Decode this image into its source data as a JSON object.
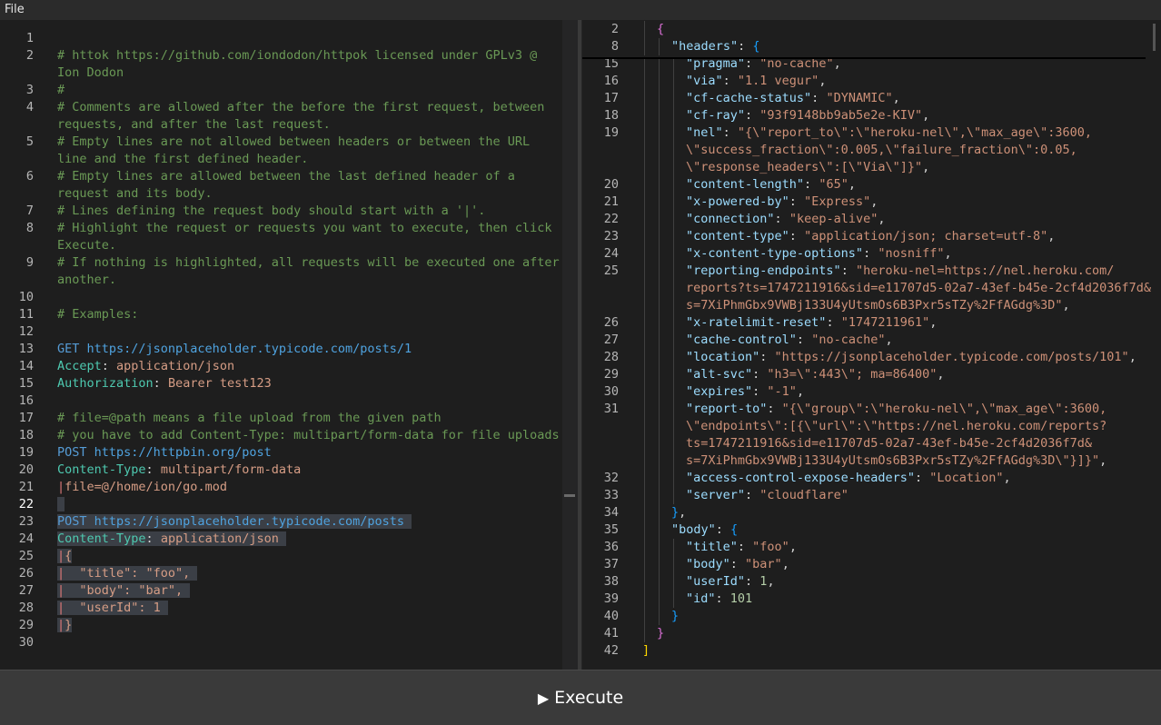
{
  "menu": {
    "file": "File"
  },
  "execute": {
    "icon": "play-icon",
    "label": "Execute"
  },
  "editor": {
    "lines": [
      {
        "n": "1"
      },
      {
        "n": "2",
        "segs": [
          {
            "t": "# httok https://github.com/iondodon/httpok licensed under GPLv3 @",
            "c": "comment"
          }
        ]
      },
      {
        "segs": [
          {
            "t": "Ion Dodon",
            "c": "comment"
          }
        ]
      },
      {
        "n": "3",
        "segs": [
          {
            "t": "#",
            "c": "comment"
          }
        ]
      },
      {
        "n": "4",
        "segs": [
          {
            "t": "# Comments are allowed after the before the first request, between",
            "c": "comment"
          }
        ]
      },
      {
        "segs": [
          {
            "t": "requests, and after the last request.",
            "c": "comment"
          }
        ]
      },
      {
        "n": "5",
        "segs": [
          {
            "t": "# Empty lines are not allowed between headers or between the URL",
            "c": "comment"
          }
        ]
      },
      {
        "segs": [
          {
            "t": "line and the first defined header.",
            "c": "comment"
          }
        ]
      },
      {
        "n": "6",
        "segs": [
          {
            "t": "# Empty lines are allowed between the last defined header of a",
            "c": "comment"
          }
        ]
      },
      {
        "segs": [
          {
            "t": "request and its body.",
            "c": "comment"
          }
        ]
      },
      {
        "n": "7",
        "segs": [
          {
            "t": "# Lines defining the request body should start with a '|'.",
            "c": "comment"
          }
        ]
      },
      {
        "n": "8",
        "segs": [
          {
            "t": "# Highlight the request or requests you want to execute, then click",
            "c": "comment"
          }
        ]
      },
      {
        "segs": [
          {
            "t": "Execute.",
            "c": "comment"
          }
        ]
      },
      {
        "n": "9",
        "segs": [
          {
            "t": "# If nothing is highlighted, all requests will be executed one after",
            "c": "comment"
          }
        ]
      },
      {
        "segs": [
          {
            "t": "another.",
            "c": "comment"
          }
        ]
      },
      {
        "n": "10"
      },
      {
        "n": "11",
        "segs": [
          {
            "t": "# Examples:",
            "c": "comment"
          }
        ]
      },
      {
        "n": "12"
      },
      {
        "n": "13",
        "segs": [
          {
            "t": "GET ",
            "c": "method"
          },
          {
            "t": "https://jsonplaceholder.typicode.com/posts/1",
            "c": "url"
          }
        ]
      },
      {
        "n": "14",
        "segs": [
          {
            "t": "Accept",
            "c": "hkey"
          },
          {
            "t": ": ",
            "c": "plain"
          },
          {
            "t": "application/json",
            "c": "hval"
          }
        ]
      },
      {
        "n": "15",
        "segs": [
          {
            "t": "Authorization",
            "c": "hkey"
          },
          {
            "t": ": ",
            "c": "plain"
          },
          {
            "t": "Bearer test123",
            "c": "hval"
          }
        ]
      },
      {
        "n": "16"
      },
      {
        "n": "17",
        "segs": [
          {
            "t": "# file=@path means a file upload from the given path",
            "c": "comment"
          }
        ]
      },
      {
        "n": "18",
        "segs": [
          {
            "t": "# you have to add Content-Type: multipart/form-data for file uploads",
            "c": "comment"
          }
        ]
      },
      {
        "n": "19",
        "segs": [
          {
            "t": "POST ",
            "c": "method"
          },
          {
            "t": "https://httpbin.org/post",
            "c": "url"
          }
        ]
      },
      {
        "n": "20",
        "segs": [
          {
            "t": "Content-Type",
            "c": "hkey"
          },
          {
            "t": ": ",
            "c": "plain"
          },
          {
            "t": "multipart/form-data",
            "c": "hval"
          }
        ]
      },
      {
        "n": "21",
        "segs": [
          {
            "t": "|",
            "c": "pipe"
          },
          {
            "t": "file=@/home/ion/go.mod",
            "c": "body"
          }
        ]
      },
      {
        "n": "22",
        "active": true,
        "hl": true,
        "segs": [
          {
            "t": " ",
            "c": "plain"
          }
        ]
      },
      {
        "n": "23",
        "hl": true,
        "segs": [
          {
            "t": "POST ",
            "c": "method"
          },
          {
            "t": "https://jsonplaceholder.typicode.com/posts ",
            "c": "url"
          }
        ]
      },
      {
        "n": "24",
        "hl": true,
        "segs": [
          {
            "t": "Content-Type",
            "c": "hkey"
          },
          {
            "t": ": ",
            "c": "plain"
          },
          {
            "t": "application/json ",
            "c": "hval"
          }
        ]
      },
      {
        "n": "25",
        "hl": true,
        "segs": [
          {
            "t": "|",
            "c": "pipe"
          },
          {
            "t": "{",
            "c": "body"
          }
        ]
      },
      {
        "n": "26",
        "hl": true,
        "segs": [
          {
            "t": "|",
            "c": "pipe"
          },
          {
            "t": "  \"title\": \"foo\", ",
            "c": "body"
          }
        ]
      },
      {
        "n": "27",
        "hl": true,
        "segs": [
          {
            "t": "|",
            "c": "pipe"
          },
          {
            "t": "  \"body\": \"bar\", ",
            "c": "body"
          }
        ]
      },
      {
        "n": "28",
        "hl": true,
        "segs": [
          {
            "t": "|",
            "c": "pipe"
          },
          {
            "t": "  \"userId\": 1 ",
            "c": "body"
          }
        ]
      },
      {
        "n": "29",
        "hl": true,
        "segs": [
          {
            "t": "|",
            "c": "pipe"
          },
          {
            "t": "}",
            "c": "body"
          }
        ]
      },
      {
        "n": "30"
      }
    ]
  },
  "response": {
    "sticky": [
      {
        "n": "2",
        "indent": 1,
        "segs": [
          {
            "t": "{",
            "c": "br1"
          }
        ]
      },
      {
        "n": "8",
        "indent": 2,
        "segs": [
          {
            "t": "\"headers\"",
            "c": "key"
          },
          {
            "t": ": ",
            "c": "punct"
          },
          {
            "t": "{",
            "c": "br2"
          }
        ]
      }
    ],
    "lines": [
      {
        "n": "15",
        "indent": 3,
        "segs": [
          {
            "t": "\"pragma\"",
            "c": "key"
          },
          {
            "t": ": ",
            "c": "punct"
          },
          {
            "t": "\"no-cache\"",
            "c": "str"
          },
          {
            "t": ",",
            "c": "punct"
          }
        ]
      },
      {
        "n": "16",
        "indent": 3,
        "segs": [
          {
            "t": "\"via\"",
            "c": "key"
          },
          {
            "t": ": ",
            "c": "punct"
          },
          {
            "t": "\"1.1 vegur\"",
            "c": "str"
          },
          {
            "t": ",",
            "c": "punct"
          }
        ]
      },
      {
        "n": "17",
        "indent": 3,
        "segs": [
          {
            "t": "\"cf-cache-status\"",
            "c": "key"
          },
          {
            "t": ": ",
            "c": "punct"
          },
          {
            "t": "\"DYNAMIC\"",
            "c": "str"
          },
          {
            "t": ",",
            "c": "punct"
          }
        ]
      },
      {
        "n": "18",
        "indent": 3,
        "segs": [
          {
            "t": "\"cf-ray\"",
            "c": "key"
          },
          {
            "t": ": ",
            "c": "punct"
          },
          {
            "t": "\"93f9148bb9ab5e2e-KIV\"",
            "c": "str"
          },
          {
            "t": ",",
            "c": "punct"
          }
        ]
      },
      {
        "n": "19",
        "indent": 3,
        "segs": [
          {
            "t": "\"nel\"",
            "c": "key"
          },
          {
            "t": ": ",
            "c": "punct"
          },
          {
            "t": "\"{\\\"report_to\\\":\\\"heroku-nel\\\",\\\"max_age\\\":3600,",
            "c": "str"
          }
        ]
      },
      {
        "indent": 3,
        "segs": [
          {
            "t": "\\\"success_fraction\\\":0.005,\\\"failure_fraction\\\":0.05,",
            "c": "str"
          }
        ]
      },
      {
        "indent": 3,
        "segs": [
          {
            "t": "\\\"response_headers\\\":[\\\"Via\\\"]}\"",
            "c": "str"
          },
          {
            "t": ",",
            "c": "punct"
          }
        ]
      },
      {
        "n": "20",
        "indent": 3,
        "segs": [
          {
            "t": "\"content-length\"",
            "c": "key"
          },
          {
            "t": ": ",
            "c": "punct"
          },
          {
            "t": "\"65\"",
            "c": "str"
          },
          {
            "t": ",",
            "c": "punct"
          }
        ]
      },
      {
        "n": "21",
        "indent": 3,
        "segs": [
          {
            "t": "\"x-powered-by\"",
            "c": "key"
          },
          {
            "t": ": ",
            "c": "punct"
          },
          {
            "t": "\"Express\"",
            "c": "str"
          },
          {
            "t": ",",
            "c": "punct"
          }
        ]
      },
      {
        "n": "22",
        "indent": 3,
        "segs": [
          {
            "t": "\"connection\"",
            "c": "key"
          },
          {
            "t": ": ",
            "c": "punct"
          },
          {
            "t": "\"keep-alive\"",
            "c": "str"
          },
          {
            "t": ",",
            "c": "punct"
          }
        ]
      },
      {
        "n": "23",
        "indent": 3,
        "segs": [
          {
            "t": "\"content-type\"",
            "c": "key"
          },
          {
            "t": ": ",
            "c": "punct"
          },
          {
            "t": "\"application/json; charset=utf-8\"",
            "c": "str"
          },
          {
            "t": ",",
            "c": "punct"
          }
        ]
      },
      {
        "n": "24",
        "indent": 3,
        "segs": [
          {
            "t": "\"x-content-type-options\"",
            "c": "key"
          },
          {
            "t": ": ",
            "c": "punct"
          },
          {
            "t": "\"nosniff\"",
            "c": "str"
          },
          {
            "t": ",",
            "c": "punct"
          }
        ]
      },
      {
        "n": "25",
        "indent": 3,
        "segs": [
          {
            "t": "\"reporting-endpoints\"",
            "c": "key"
          },
          {
            "t": ": ",
            "c": "punct"
          },
          {
            "t": "\"heroku-nel=https://nel.heroku.com/",
            "c": "str"
          }
        ]
      },
      {
        "indent": 3,
        "segs": [
          {
            "t": "reports?ts=1747211916&sid=e11707d5-02a7-43ef-b45e-2cf4d2036f7d&",
            "c": "str"
          }
        ]
      },
      {
        "indent": 3,
        "segs": [
          {
            "t": "s=7XiPhmGbx9VWBj133U4yUtsmOs6B3Pxr5sTZy%2FfAGdg%3D\"",
            "c": "str"
          },
          {
            "t": ",",
            "c": "punct"
          }
        ]
      },
      {
        "n": "26",
        "indent": 3,
        "segs": [
          {
            "t": "\"x-ratelimit-reset\"",
            "c": "key"
          },
          {
            "t": ": ",
            "c": "punct"
          },
          {
            "t": "\"1747211961\"",
            "c": "str"
          },
          {
            "t": ",",
            "c": "punct"
          }
        ]
      },
      {
        "n": "27",
        "indent": 3,
        "segs": [
          {
            "t": "\"cache-control\"",
            "c": "key"
          },
          {
            "t": ": ",
            "c": "punct"
          },
          {
            "t": "\"no-cache\"",
            "c": "str"
          },
          {
            "t": ",",
            "c": "punct"
          }
        ]
      },
      {
        "n": "28",
        "indent": 3,
        "segs": [
          {
            "t": "\"location\"",
            "c": "key"
          },
          {
            "t": ": ",
            "c": "punct"
          },
          {
            "t": "\"https://jsonplaceholder.typicode.com/posts/101\"",
            "c": "str"
          },
          {
            "t": ",",
            "c": "punct"
          }
        ]
      },
      {
        "n": "29",
        "indent": 3,
        "segs": [
          {
            "t": "\"alt-svc\"",
            "c": "key"
          },
          {
            "t": ": ",
            "c": "punct"
          },
          {
            "t": "\"h3=\\\":443\\\"; ma=86400\"",
            "c": "str"
          },
          {
            "t": ",",
            "c": "punct"
          }
        ]
      },
      {
        "n": "30",
        "indent": 3,
        "segs": [
          {
            "t": "\"expires\"",
            "c": "key"
          },
          {
            "t": ": ",
            "c": "punct"
          },
          {
            "t": "\"-1\"",
            "c": "str"
          },
          {
            "t": ",",
            "c": "punct"
          }
        ]
      },
      {
        "n": "31",
        "indent": 3,
        "segs": [
          {
            "t": "\"report-to\"",
            "c": "key"
          },
          {
            "t": ": ",
            "c": "punct"
          },
          {
            "t": "\"{\\\"group\\\":\\\"heroku-nel\\\",\\\"max_age\\\":3600,",
            "c": "str"
          }
        ]
      },
      {
        "indent": 3,
        "segs": [
          {
            "t": "\\\"endpoints\\\":[{\\\"url\\\":\\\"https://nel.heroku.com/reports?",
            "c": "str"
          }
        ]
      },
      {
        "indent": 3,
        "segs": [
          {
            "t": "ts=1747211916&sid=e11707d5-02a7-43ef-b45e-2cf4d2036f7d&",
            "c": "str"
          }
        ]
      },
      {
        "indent": 3,
        "segs": [
          {
            "t": "s=7XiPhmGbx9VWBj133U4yUtsmOs6B3Pxr5sTZy%2FfAGdg%3D\\\"}]}\"",
            "c": "str"
          },
          {
            "t": ",",
            "c": "punct"
          }
        ]
      },
      {
        "n": "32",
        "indent": 3,
        "segs": [
          {
            "t": "\"access-control-expose-headers\"",
            "c": "key"
          },
          {
            "t": ": ",
            "c": "punct"
          },
          {
            "t": "\"Location\"",
            "c": "str"
          },
          {
            "t": ",",
            "c": "punct"
          }
        ]
      },
      {
        "n": "33",
        "indent": 3,
        "segs": [
          {
            "t": "\"server\"",
            "c": "key"
          },
          {
            "t": ": ",
            "c": "punct"
          },
          {
            "t": "\"cloudflare\"",
            "c": "str"
          }
        ]
      },
      {
        "n": "34",
        "indent": 2,
        "segs": [
          {
            "t": "}",
            "c": "br2"
          },
          {
            "t": ",",
            "c": "punct"
          }
        ]
      },
      {
        "n": "35",
        "indent": 2,
        "segs": [
          {
            "t": "\"body\"",
            "c": "key"
          },
          {
            "t": ": ",
            "c": "punct"
          },
          {
            "t": "{",
            "c": "br2"
          }
        ]
      },
      {
        "n": "36",
        "indent": 3,
        "segs": [
          {
            "t": "\"title\"",
            "c": "key"
          },
          {
            "t": ": ",
            "c": "punct"
          },
          {
            "t": "\"foo\"",
            "c": "str"
          },
          {
            "t": ",",
            "c": "punct"
          }
        ]
      },
      {
        "n": "37",
        "indent": 3,
        "segs": [
          {
            "t": "\"body\"",
            "c": "key"
          },
          {
            "t": ": ",
            "c": "punct"
          },
          {
            "t": "\"bar\"",
            "c": "str"
          },
          {
            "t": ",",
            "c": "punct"
          }
        ]
      },
      {
        "n": "38",
        "indent": 3,
        "segs": [
          {
            "t": "\"userId\"",
            "c": "key"
          },
          {
            "t": ": ",
            "c": "punct"
          },
          {
            "t": "1",
            "c": "num"
          },
          {
            "t": ",",
            "c": "punct"
          }
        ]
      },
      {
        "n": "39",
        "indent": 3,
        "segs": [
          {
            "t": "\"id\"",
            "c": "key"
          },
          {
            "t": ": ",
            "c": "punct"
          },
          {
            "t": "101",
            "c": "num"
          }
        ]
      },
      {
        "n": "40",
        "indent": 2,
        "segs": [
          {
            "t": "}",
            "c": "br2"
          }
        ]
      },
      {
        "n": "41",
        "indent": 1,
        "segs": [
          {
            "t": "}",
            "c": "br1"
          }
        ]
      },
      {
        "n": "42",
        "indent": 0,
        "segs": [
          {
            "t": "]",
            "c": "br0"
          }
        ]
      }
    ]
  }
}
